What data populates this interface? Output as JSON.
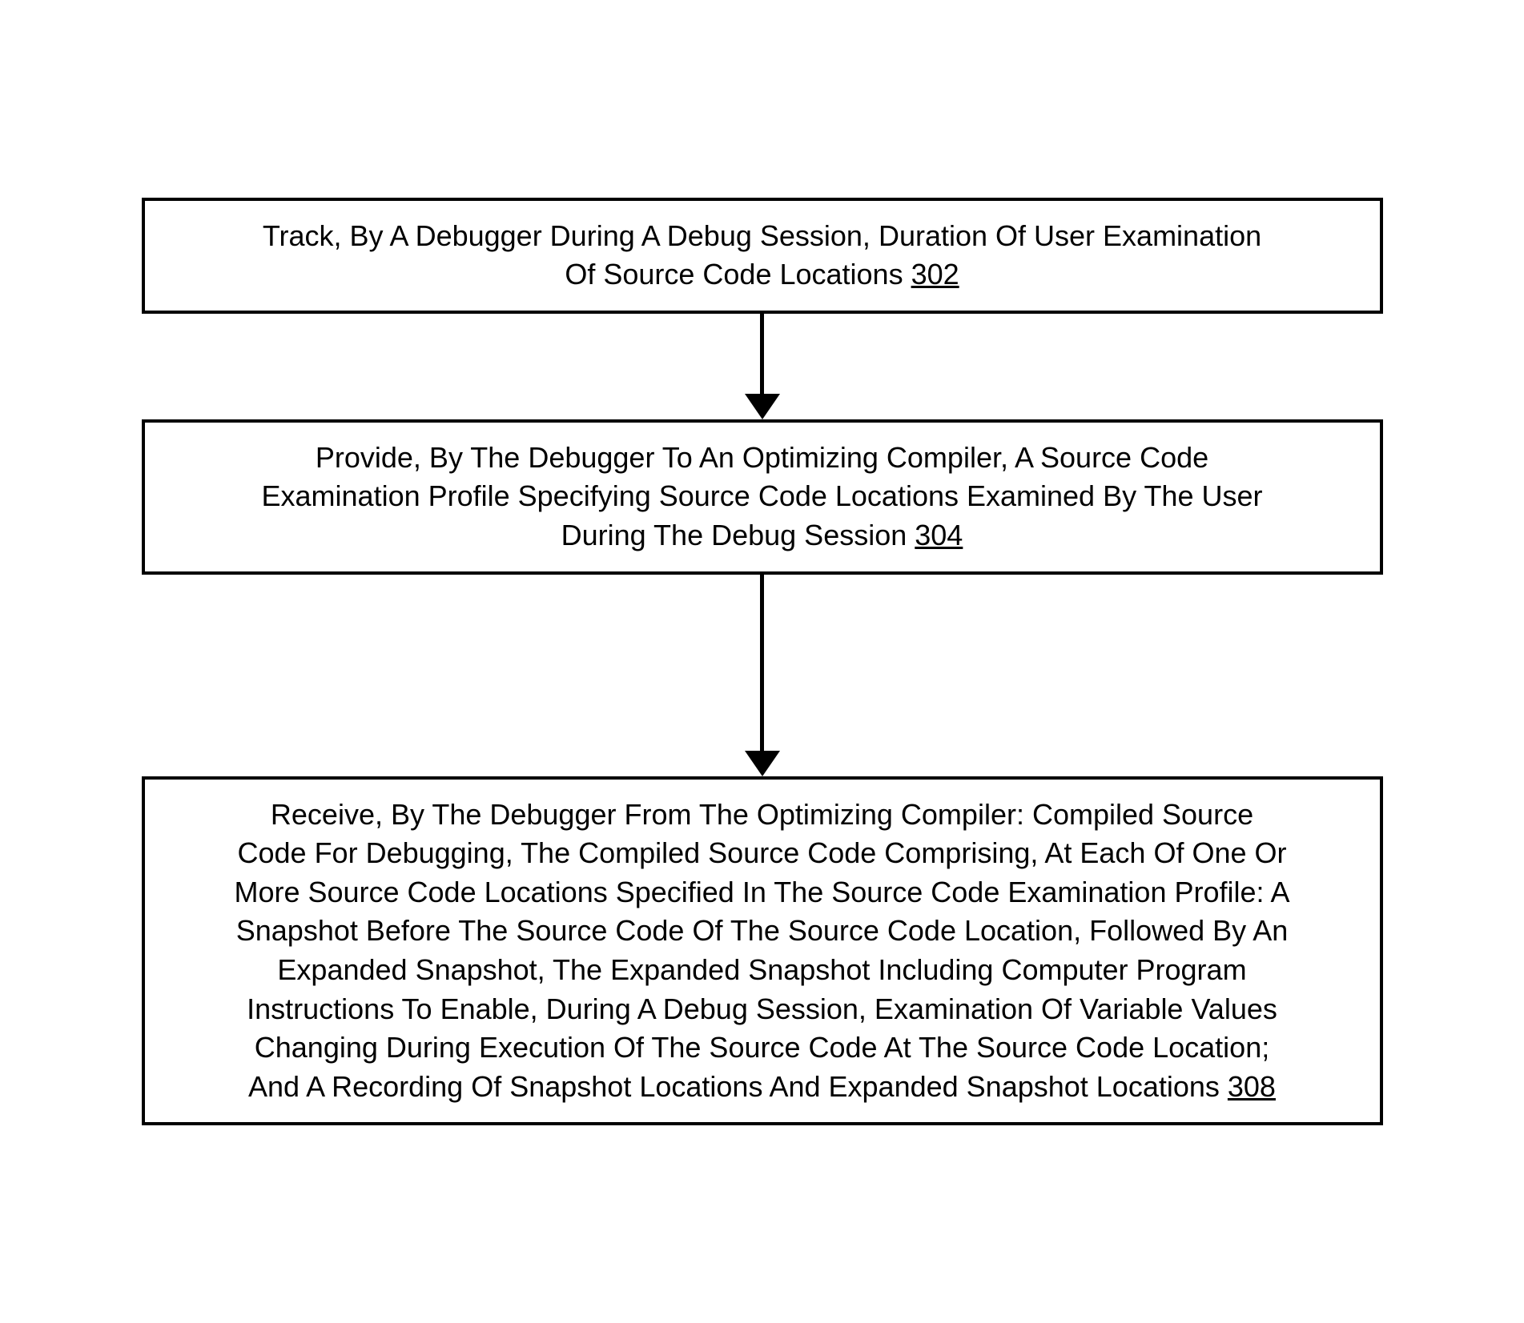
{
  "flowchart": {
    "boxes": [
      {
        "text_line1": "Track, By A Debugger During A Debug Session, Duration Of User Examination",
        "text_line2": "Of Source Code Locations ",
        "ref": "302"
      },
      {
        "text_line1": "Provide, By The Debugger To An Optimizing Compiler, A Source Code",
        "text_line2": "Examination Profile Specifying Source Code Locations Examined By The User",
        "text_line3": "During The Debug Session ",
        "ref": "304"
      },
      {
        "text_line1": "Receive, By The Debugger From The Optimizing Compiler: Compiled Source",
        "text_line2": "Code For Debugging, The Compiled Source Code Comprising, At Each Of One Or",
        "text_line3": "More Source Code Locations Specified In The Source Code Examination Profile: A",
        "text_line4": "Snapshot Before The Source Code Of The Source Code Location, Followed By An",
        "text_line5": "Expanded Snapshot, The Expanded Snapshot Including Computer Program",
        "text_line6": "Instructions To Enable, During A Debug Session, Examination Of Variable Values",
        "text_line7": "Changing During Execution Of The Source Code At The Source Code Location;",
        "text_line8": "And A Recording Of Snapshot Locations And Expanded Snapshot Locations ",
        "ref": "308"
      }
    ]
  }
}
